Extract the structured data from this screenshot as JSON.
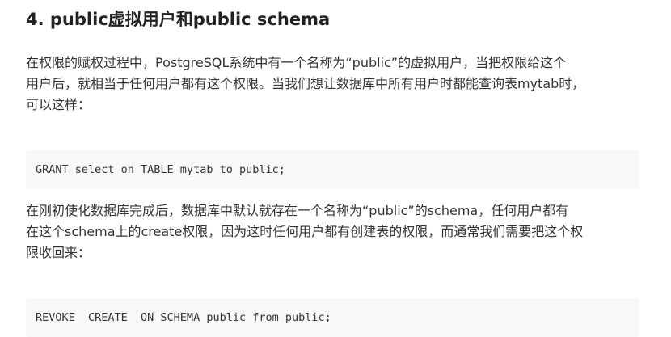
{
  "section": {
    "heading": "4. public虚拟用户和public schema"
  },
  "paragraph1": {
    "lines": [
      "在权限的赋权过程中，PostgreSQL系统中有一个名称为“public”的虚拟用户，当把权限给这个",
      "用户后，就相当于任何用户都有这个权限。当我们想让数据库中所有用户时都能查询表mytab时，",
      "可以这样："
    ]
  },
  "code1": {
    "text": "GRANT select on TABLE mytab to public;"
  },
  "paragraph2": {
    "lines": [
      "在刚初使化数据库完成后，数据库中默认就存在一个名称为“public”的schema，任何用户都有",
      "在这个schema上的create权限，因为这时任何用户都有创建表的权限，而通常我们需要把这个权",
      "限收回来："
    ]
  },
  "code2": {
    "text": "REVOKE  CREATE  ON SCHEMA public from public;"
  }
}
